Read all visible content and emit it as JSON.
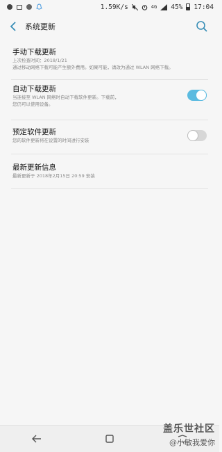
{
  "status_bar": {
    "speed": "1.59K/s",
    "network": "4G",
    "battery": "45%",
    "time": "17:04"
  },
  "header": {
    "title": "系统更新"
  },
  "items": [
    {
      "title": "手动下载更新",
      "desc": "上次检查时间：2018/1/21\n通过移动网络下载可能产生额外费用。如果可能，请改为通过 WLAN 网络下载。"
    },
    {
      "title": "自动下载更新",
      "desc": "当连接至 WLAN 网络时自动下载软件更新。下载前，\n您仍可以使用设备。",
      "toggle": true
    },
    {
      "title": "预定软件更新",
      "desc": "您的软件更新将在设置的时间进行安装",
      "toggle": false
    },
    {
      "title": "最新更新信息",
      "desc": "最新更新于 2018年2月15日 20:59 安装"
    }
  ],
  "watermark": {
    "line1": "盖乐世社区",
    "line2": "@小敏我爱你"
  }
}
